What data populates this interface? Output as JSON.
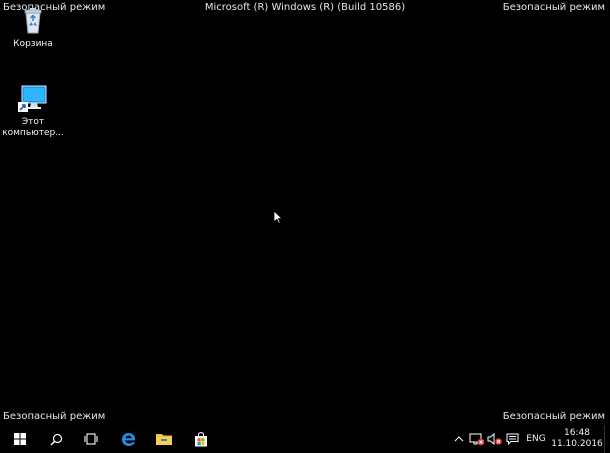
{
  "watermark": {
    "top_left": "Безопасный режим",
    "top_right": "Безопасный режим",
    "top_center": "Microsoft (R) Windows (R) (Build 10586)",
    "bottom_left": "Безопасный режим",
    "bottom_right": "Безопасный режим"
  },
  "desktop": {
    "icons": [
      {
        "label": "Корзина",
        "icon": "recycle-bin-icon"
      },
      {
        "label": "Этот компьютер...",
        "icon": "this-pc-icon"
      }
    ]
  },
  "taskbar": {
    "apps": [
      {
        "icon": "windows-start-icon"
      },
      {
        "icon": "search-icon"
      },
      {
        "icon": "task-view-icon"
      },
      {
        "icon": "edge-icon"
      },
      {
        "icon": "file-explorer-icon"
      },
      {
        "icon": "store-icon"
      }
    ],
    "tray": {
      "language": "ENG",
      "time": "16:48",
      "date": "11.10.2016"
    }
  },
  "colors": {
    "desktop_background": "#000000",
    "edge_blue": "#1e8fe6",
    "folder_yellow": "#f3c13a",
    "error_red": "#e53935"
  }
}
